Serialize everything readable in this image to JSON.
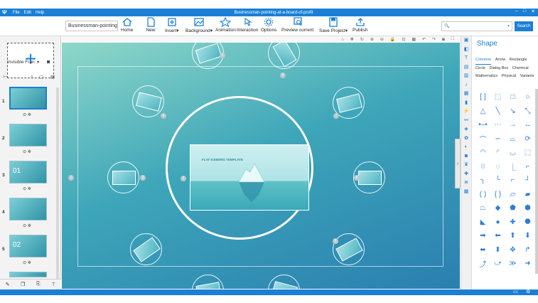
{
  "titlebar": {
    "menu": [
      "File",
      "Edit",
      "Help"
    ],
    "title": "Businessman-pointing-at-a-board-of-profit"
  },
  "toolbar": {
    "project_name": "Businessman-pointing",
    "buttons": [
      "Home",
      "New",
      "Insert",
      "Background",
      "Animation",
      "Interaction",
      "Options",
      "Preview current",
      "Save Project",
      "Publish"
    ],
    "search_button": "Search"
  },
  "left_panel": {
    "frame_type": "Invisible Fran",
    "thumbnails": [
      {
        "num": "1",
        "title": "FLAT ICEBERG TEMPLATE"
      },
      {
        "num": "2",
        "title": ""
      },
      {
        "num": "3",
        "title": "01"
      },
      {
        "num": "4",
        "title": ""
      },
      {
        "num": "5",
        "title": "02"
      }
    ]
  },
  "canvas": {
    "center_title": "FLAT ICEBERG TEMPLATE",
    "path_numbers": [
      "1",
      "2",
      "3",
      "4",
      "5",
      "6",
      "7",
      "8",
      "9"
    ]
  },
  "right_panel": {
    "title": "Shape",
    "tabs": [
      "Common",
      "Arrow",
      "Rectangle",
      "Circle",
      "Dialog Box",
      "Chemical",
      "Mathematics",
      "Physical",
      "Variants"
    ],
    "selected_tab": "Common"
  },
  "colors": {
    "accent": "#1a7fd6",
    "canvas_teal": "#3ea6b9"
  }
}
